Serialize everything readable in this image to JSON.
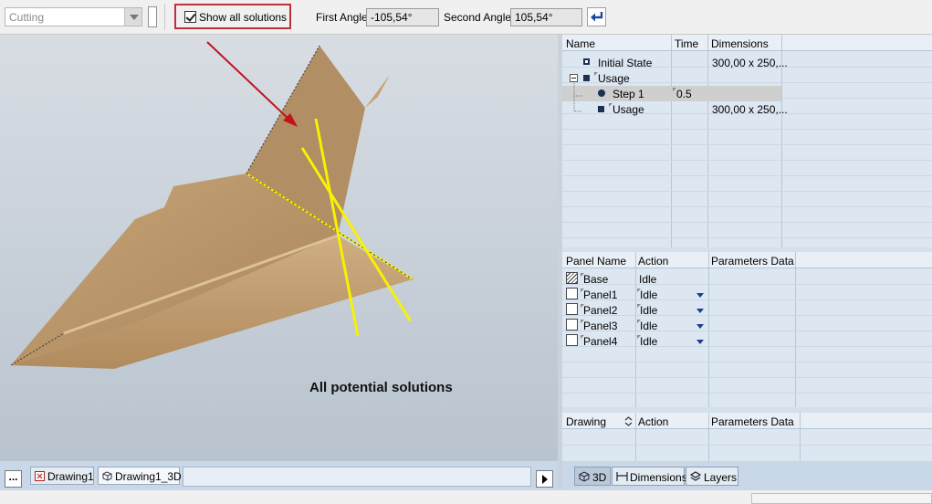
{
  "toolbar": {
    "mode_combo_value": "Cutting",
    "show_all_solutions_label": "Show all solutions",
    "show_all_solutions_checked": true,
    "first_angle_label": "First Angle",
    "first_angle_value": "-105,54°",
    "second_angle_label": "Second Angle",
    "second_angle_value": "105,54°"
  },
  "viewport": {
    "caption": "All potential solutions",
    "annotation_arrow_color": "#c0141c",
    "solution_line_color": "#f5f000",
    "model_color": "#b89468"
  },
  "drawing_tabs": {
    "more_label": "...",
    "tabs": [
      {
        "label": "Drawing1",
        "active": false
      },
      {
        "label": "Drawing1_3D",
        "active": true
      }
    ]
  },
  "steps_grid": {
    "headers": [
      "Name",
      "Time",
      "Dimensions"
    ],
    "rows": [
      {
        "name": "Initial State",
        "time": "",
        "dimensions": "300,00 x 250,..."
      },
      {
        "name": "Usage",
        "time": "",
        "dimensions": ""
      },
      {
        "name": "Step 1",
        "time": "0.5",
        "dimensions": "",
        "selected": true
      },
      {
        "name": "Usage",
        "time": "",
        "dimensions": "300,00 x 250,..."
      }
    ]
  },
  "panels_grid": {
    "headers": [
      "Panel Name",
      "Action",
      "Parameters Data"
    ],
    "rows": [
      {
        "name": "Base",
        "action": "Idle"
      },
      {
        "name": "Panel1",
        "action": "Idle"
      },
      {
        "name": "Panel2",
        "action": "Idle"
      },
      {
        "name": "Panel3",
        "action": "Idle"
      },
      {
        "name": "Panel4",
        "action": "Idle"
      }
    ]
  },
  "drawing_grid": {
    "headers": [
      "Drawing",
      "Action",
      "Parameters Data"
    ]
  },
  "right_tabs": [
    {
      "label": "3D",
      "active": true
    },
    {
      "label": "Dimensions",
      "active": false
    },
    {
      "label": "Layers",
      "active": false
    }
  ]
}
